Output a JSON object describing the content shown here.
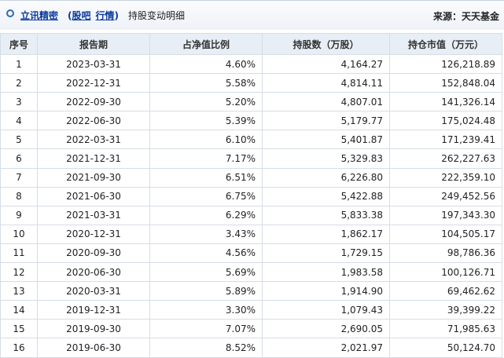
{
  "header": {
    "link_main": "立讯精密",
    "link_quote": "股吧",
    "link_market": "行情",
    "paren_open": "(",
    "paren_close": ")",
    "title": "持股变动明细",
    "source": "来源：天天基金"
  },
  "table": {
    "columns": [
      "序号",
      "报告期",
      "占净值比例",
      "持股数（万股）",
      "持仓市值（万元）"
    ],
    "rows": [
      [
        "1",
        "2023-03-31",
        "4.60%",
        "4,164.27",
        "126,218.89"
      ],
      [
        "2",
        "2022-12-31",
        "5.58%",
        "4,814.11",
        "152,848.04"
      ],
      [
        "3",
        "2022-09-30",
        "5.20%",
        "4,807.01",
        "141,326.14"
      ],
      [
        "4",
        "2022-06-30",
        "5.39%",
        "5,179.77",
        "175,024.48"
      ],
      [
        "5",
        "2022-03-31",
        "6.10%",
        "5,401.87",
        "171,239.41"
      ],
      [
        "6",
        "2021-12-31",
        "7.17%",
        "5,329.83",
        "262,227.63"
      ],
      [
        "7",
        "2021-09-30",
        "6.51%",
        "6,226.80",
        "222,359.10"
      ],
      [
        "8",
        "2021-06-30",
        "6.75%",
        "5,422.88",
        "249,452.56"
      ],
      [
        "9",
        "2021-03-31",
        "6.29%",
        "5,833.38",
        "197,343.30"
      ],
      [
        "10",
        "2020-12-31",
        "3.43%",
        "1,862.17",
        "104,505.17"
      ],
      [
        "11",
        "2020-09-30",
        "4.56%",
        "1,729.15",
        "98,786.36"
      ],
      [
        "12",
        "2020-06-30",
        "5.69%",
        "1,983.58",
        "100,126.71"
      ],
      [
        "13",
        "2020-03-31",
        "5.89%",
        "1,914.90",
        "69,462.62"
      ],
      [
        "14",
        "2019-12-31",
        "3.30%",
        "1,079.43",
        "39,399.22"
      ],
      [
        "15",
        "2019-09-30",
        "7.07%",
        "2,690.05",
        "71,985.63"
      ],
      [
        "16",
        "2019-06-30",
        "8.52%",
        "2,021.97",
        "50,124.70"
      ]
    ]
  }
}
